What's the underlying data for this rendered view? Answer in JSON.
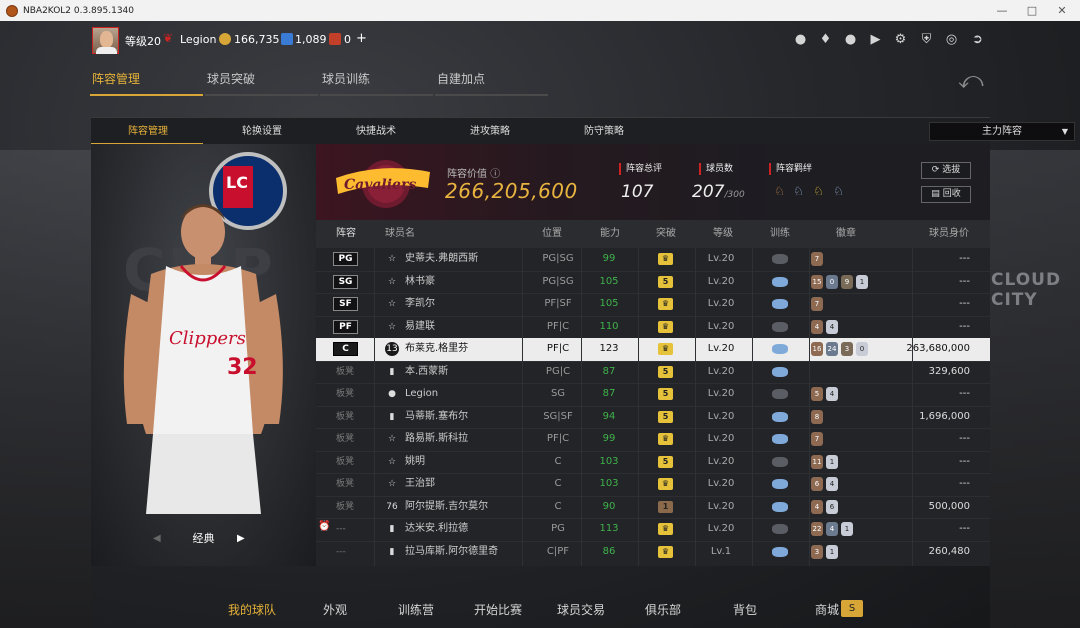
{
  "window": {
    "title": "NBA2KOL2 0.3.895.1340"
  },
  "topbar": {
    "level": "等级20",
    "username": "Legion",
    "coins": "166,735",
    "points": "1,089",
    "vouchers": "0",
    "plus": "+"
  },
  "main_tabs": [
    {
      "label": "阵容管理",
      "active": true
    },
    {
      "label": "球员突破",
      "active": false
    },
    {
      "label": "球员训练",
      "active": false
    },
    {
      "label": "自建加点",
      "active": false
    }
  ],
  "sub_tabs": [
    {
      "label": "阵容管理",
      "active": true
    },
    {
      "label": "轮换设置",
      "active": false
    },
    {
      "label": "快捷战术",
      "active": false
    },
    {
      "label": "进攻策略",
      "active": false
    },
    {
      "label": "防守策略",
      "active": false
    }
  ],
  "lineup_select": "主力阵容",
  "left_panel": {
    "mode": "经典"
  },
  "team": {
    "value_label": "阵容价值",
    "value": "266,205,600",
    "rating_label": "阵容总评",
    "rating": "107",
    "count_label": "球员数",
    "count": "207",
    "count_max": "/300",
    "bond_label": "阵容羁绊",
    "btn_select": "选拔",
    "btn_recycle": "回收"
  },
  "table": {
    "headers": [
      "阵容",
      "球员名",
      "位置",
      "能力",
      "突破",
      "等级",
      "训练",
      "徽章",
      "球员身价"
    ],
    "rows": [
      {
        "slot": "PG",
        "bench": false,
        "icon": "star",
        "name": "史蒂夫.弗朗西斯",
        "position": "PG|SG",
        "ability": "99",
        "breakthrough": "crown",
        "level": "Lv.20",
        "badges": [
          "7"
        ],
        "value": "---"
      },
      {
        "slot": "SG",
        "bench": false,
        "icon": "star",
        "name": "林书豪",
        "position": "PG|SG",
        "ability": "105",
        "breakthrough": "5",
        "level": "Lv.20",
        "badges": [
          "15",
          "0",
          "9",
          "1"
        ],
        "value": "---"
      },
      {
        "slot": "SF",
        "bench": false,
        "icon": "star",
        "name": "李凯尔",
        "position": "PF|SF",
        "ability": "105",
        "breakthrough": "crown",
        "level": "Lv.20",
        "badges": [
          "7"
        ],
        "value": "---"
      },
      {
        "slot": "PF",
        "bench": false,
        "icon": "star",
        "name": "易建联",
        "position": "PF|C",
        "ability": "110",
        "breakthrough": "crown",
        "level": "Lv.20",
        "badges": [
          "4",
          "4"
        ],
        "value": "---"
      },
      {
        "slot": "C",
        "bench": false,
        "icon": "13",
        "name": "布莱克.格里芬",
        "position": "PF|C",
        "ability": "123",
        "breakthrough": "crown",
        "level": "Lv.20",
        "badges": [
          "16",
          "24",
          "3",
          "0"
        ],
        "value": "263,680,000",
        "selected": true
      },
      {
        "slot": "板凳",
        "bench": true,
        "icon": "bars",
        "name": "本.西蒙斯",
        "position": "PG|C",
        "ability": "87",
        "breakthrough": "5",
        "level": "Lv.20",
        "badges": [],
        "value": "329,600"
      },
      {
        "slot": "板凳",
        "bench": true,
        "icon": "person",
        "name": "Legion",
        "position": "SG",
        "ability": "87",
        "breakthrough": "5",
        "level": "Lv.20",
        "badges": [
          "5",
          "4"
        ],
        "value": "---"
      },
      {
        "slot": "板凳",
        "bench": true,
        "icon": "bars",
        "name": "马蒂斯.塞布尔",
        "position": "SG|SF",
        "ability": "94",
        "breakthrough": "5",
        "level": "Lv.20",
        "badges": [
          "8"
        ],
        "value": "1,696,000"
      },
      {
        "slot": "板凳",
        "bench": true,
        "icon": "star",
        "name": "路易斯.斯科拉",
        "position": "PF|C",
        "ability": "99",
        "breakthrough": "crown",
        "level": "Lv.20",
        "badges": [
          "7"
        ],
        "value": "---"
      },
      {
        "slot": "板凳",
        "bench": true,
        "icon": "star",
        "name": "姚明",
        "position": "C",
        "ability": "103",
        "breakthrough": "5",
        "level": "Lv.20",
        "badges": [
          "11",
          "1"
        ],
        "value": "---"
      },
      {
        "slot": "板凳",
        "bench": true,
        "icon": "star",
        "name": "王治郅",
        "position": "C",
        "ability": "103",
        "breakthrough": "crown",
        "level": "Lv.20",
        "badges": [
          "6",
          "4"
        ],
        "value": "---"
      },
      {
        "slot": "板凳",
        "bench": true,
        "icon": "76",
        "name": "阿尔提斯.吉尔莫尔",
        "position": "C",
        "ability": "90",
        "breakthrough": "1",
        "level": "Lv.20",
        "badges": [
          "4",
          "6"
        ],
        "value": "500,000"
      },
      {
        "slot": "---",
        "bench": true,
        "icon": "bars",
        "name": "达米安.利拉德",
        "position": "PG",
        "ability": "113",
        "breakthrough": "crown",
        "level": "Lv.20",
        "badges": [
          "22",
          "4",
          "1"
        ],
        "value": "---"
      },
      {
        "slot": "---",
        "bench": true,
        "icon": "bars",
        "name": "拉马库斯.阿尔德里奇",
        "position": "C|PF",
        "ability": "86",
        "breakthrough": "crown",
        "level": "Lv.1",
        "badges": [
          "3",
          "1"
        ],
        "value": "260,480"
      }
    ]
  },
  "bottom_nav": [
    {
      "label": "我的球队",
      "active": true
    },
    {
      "label": "外观",
      "active": false
    },
    {
      "label": "训练营",
      "active": false
    },
    {
      "label": "开始比赛",
      "active": false
    },
    {
      "label": "球员交易",
      "active": false
    },
    {
      "label": "俱乐部",
      "active": false
    },
    {
      "label": "背包",
      "active": false
    },
    {
      "label": "商城",
      "active": false
    }
  ],
  "background_sign": "CLOUD CITY",
  "shop_badge": "S",
  "colors": {
    "accent": "#d8a636",
    "value_gold": "#e8b440",
    "ability_green": "#3fb24a",
    "selected_row": "#ececec"
  }
}
